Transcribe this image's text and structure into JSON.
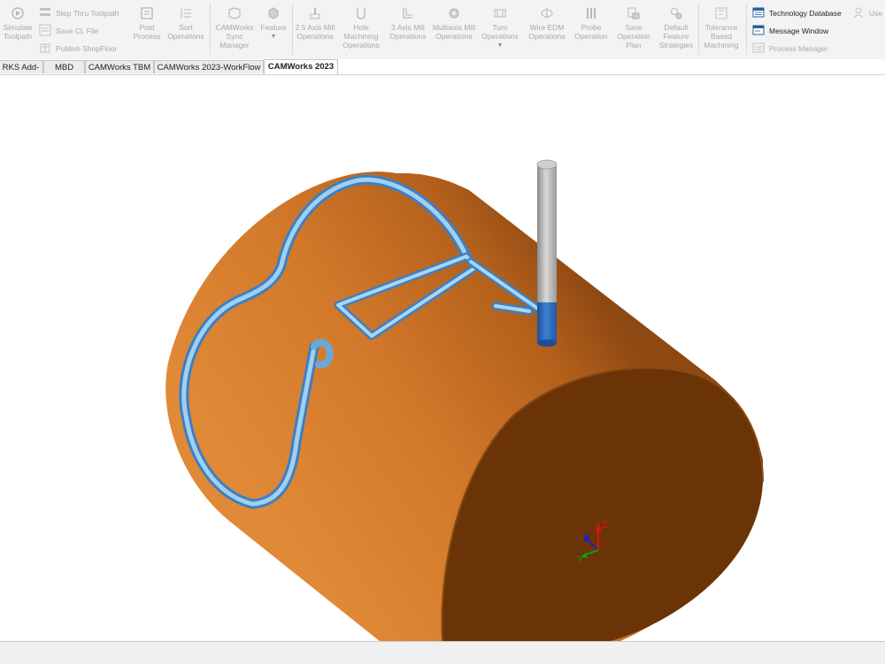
{
  "ribbon": {
    "simulate_toolpath": "Simulate Toolpath",
    "step_thru_toolpath": "Step Thru Toolpath",
    "save_cl_file": "Save CL File",
    "publish_shopfloor": "Publish ShopFloor",
    "post_process": "Post Process",
    "sort_operations": "Sort Operations",
    "sync_manager": "CAMWorks Sync Manager",
    "feature": "Feature",
    "mill_2_5_axis": "2.5 Axis Mill Operations",
    "hole_machining": "Hole Machining Operations",
    "mill_3_axis": "3 Axis Mill Operations",
    "multiaxis_mill": "Multiaxis Mill Operations",
    "turn_operations": "Turn Operations",
    "wire_edm": "Wire EDM Operations",
    "probe_operation": "Probe Operation",
    "save_operation_plan": "Save Operation Plan",
    "default_feature_strategies": "Default Feature Strategies",
    "tolerance_based_machining": "Tolerance Based Machining",
    "technology_database": "Technology Database",
    "message_window": "Message Window",
    "process_manager": "Process Manager",
    "user": "Use"
  },
  "tabs": [
    "RKS Add-Ins",
    "MBD",
    "CAMWorks TBM",
    "CAMWorks 2023-WorkFlow",
    "CAMWorks 2023"
  ],
  "active_tab": "CAMWorks 2023",
  "triad": {
    "x": "X",
    "y": "Y",
    "z": "Z"
  },
  "colors": {
    "stock_orange": "#d2782a",
    "end_face": "#6a3406",
    "groove_blue": "#8fc3ea",
    "tool_blue": "#2f6cc0",
    "tool_gray": "#b8b8b8"
  }
}
